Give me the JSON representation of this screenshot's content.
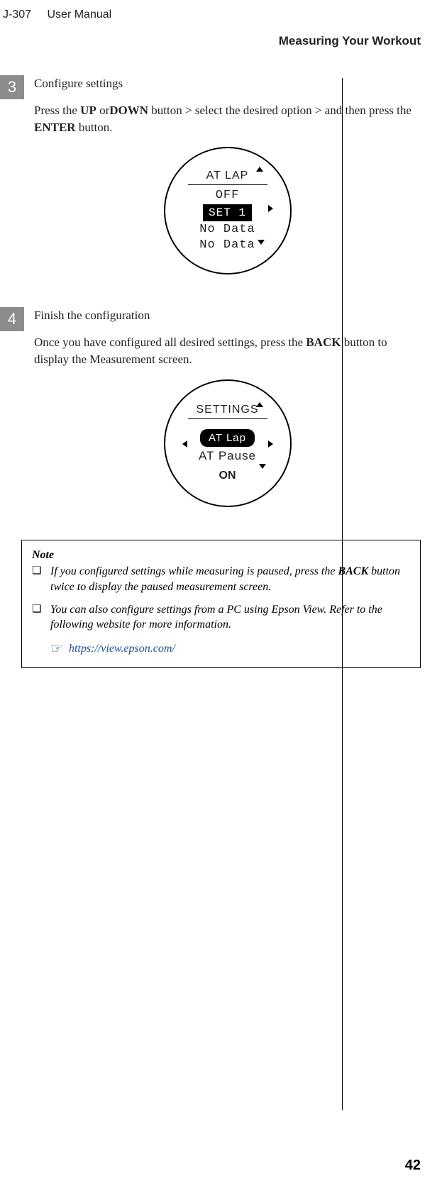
{
  "header": {
    "product": "J-307",
    "manual": "User Manual"
  },
  "breadcrumb": "Measuring Your Workout",
  "steps": [
    {
      "num": "3",
      "title": "Configure settings",
      "desc_pre": "Press the ",
      "btn1": "UP",
      "desc_mid1": " or",
      "btn2": "DOWN",
      "desc_mid2": " button > select the desired option > and then press the ",
      "btn3": "ENTER",
      "desc_post": " button.",
      "screen": {
        "title": "AT LAP",
        "line1": "OFF",
        "selected": "SET 1",
        "line2": "No Data",
        "line3": "No Data"
      }
    },
    {
      "num": "4",
      "title": "Finish the configuration",
      "desc_pre": "Once you have configured all desired settings, press the ",
      "btn1": "BACK",
      "desc_post": " button to display the Measurement screen.",
      "screen": {
        "title": "SETTINGS",
        "selected": "AT Lap",
        "line1": "AT Pause",
        "bottom": "ON"
      }
    }
  ],
  "note": {
    "title": "Note",
    "items": [
      {
        "bullet": "❏",
        "pre": "If you configured settings while measuring is paused, press the ",
        "bold": "BACK",
        "post": " button twice to display the paused measurement screen."
      },
      {
        "bullet": "❏",
        "text": "You can also configure settings from a PC using Epson View. Refer to the following website for more information."
      }
    ],
    "link_icon": "☞",
    "link": "https://view.epson.com/"
  },
  "page": "42"
}
